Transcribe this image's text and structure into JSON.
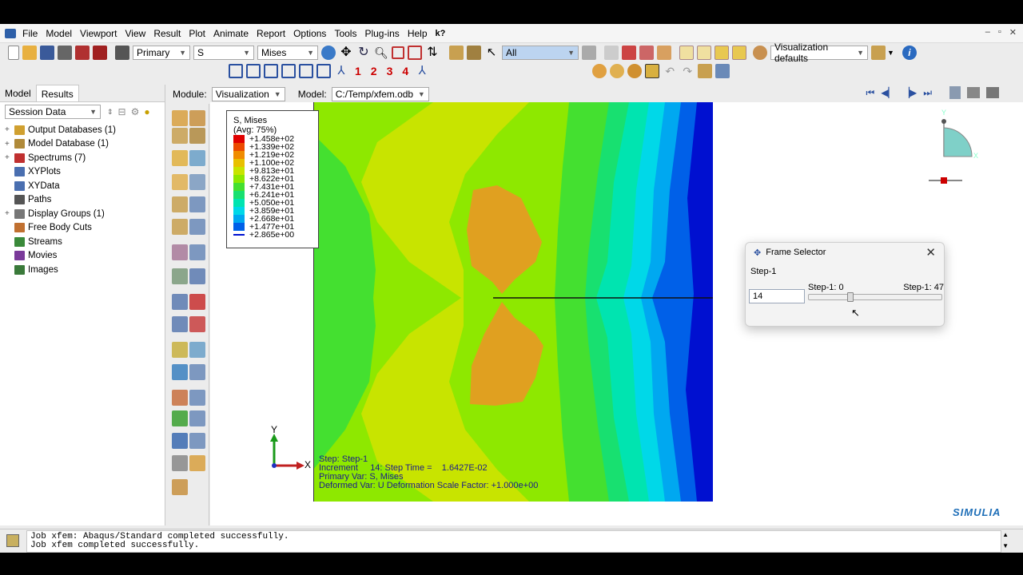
{
  "menu": [
    "File",
    "Model",
    "Viewport",
    "View",
    "Result",
    "Plot",
    "Animate",
    "Report",
    "Options",
    "Tools",
    "Plug-ins",
    "Help",
    "k?"
  ],
  "toolbar": {
    "primary": "Primary",
    "variable": "S",
    "component": "Mises",
    "selection": "All",
    "viz_defaults": "Visualization defaults",
    "view_numbers": [
      "1",
      "2",
      "3",
      "4"
    ]
  },
  "left_panel": {
    "tabs": [
      "Model",
      "Results"
    ],
    "active_tab": "Results",
    "session_select": "Session Data",
    "tree": [
      {
        "label": "Output Databases (1)",
        "expand": "+",
        "color": "#d0a030"
      },
      {
        "label": "Model Database (1)",
        "expand": "+",
        "color": "#b08a3a"
      },
      {
        "label": "Spectrums (7)",
        "expand": "+",
        "color": "#c03030"
      },
      {
        "label": "XYPlots",
        "expand": "",
        "color": "#4a6fb0"
      },
      {
        "label": "XYData",
        "expand": "",
        "color": "#4a6fb0"
      },
      {
        "label": "Paths",
        "expand": "",
        "color": "#555555"
      },
      {
        "label": "Display Groups (1)",
        "expand": "+",
        "color": "#777777"
      },
      {
        "label": "Free Body Cuts",
        "expand": "",
        "color": "#c07030"
      },
      {
        "label": "Streams",
        "expand": "",
        "color": "#3a8a3a"
      },
      {
        "label": "Movies",
        "expand": "",
        "color": "#7a3a9a"
      },
      {
        "label": "Images",
        "expand": "",
        "color": "#3a7a3a"
      }
    ]
  },
  "module": {
    "label": "Module:",
    "value": "Visualization",
    "model_label": "Model:",
    "model_value": "C:/Temp/xfem.odb"
  },
  "legend": {
    "title": "S, Mises",
    "avg": "(Avg: 75%)",
    "values": [
      "+1.458e+02",
      "+1.339e+02",
      "+1.219e+02",
      "+1.100e+02",
      "+9.813e+01",
      "+8.622e+01",
      "+7.431e+01",
      "+6.241e+01",
      "+5.050e+01",
      "+3.859e+01",
      "+2.668e+01",
      "+1.477e+01",
      "+2.865e+00"
    ],
    "colors": [
      "#e00000",
      "#ec4a00",
      "#f08c00",
      "#e8c000",
      "#c8e400",
      "#8ee800",
      "#44e030",
      "#18e070",
      "#00e4b0",
      "#00d8e8",
      "#00a8f0",
      "#0060e8",
      "#0010d0"
    ]
  },
  "step_info": {
    "line1": "Step: Step-1",
    "line2": "Increment     14: Step Time =    1.6427E-02",
    "line3": "Primary Var: S, Mises",
    "line4": "Deformed Var: U   Deformation Scale Factor: +1.000e+00"
  },
  "triad": {
    "x": "X",
    "y": "Y"
  },
  "frame_selector": {
    "title": "Frame Selector",
    "step": "Step-1",
    "value": "14",
    "min_label": "Step-1: 0",
    "max_label": "Step-1: 47",
    "position_fraction": 0.298
  },
  "console": {
    "line1": "Job xfem: Abaqus/Standard completed successfully.",
    "line2": "Job xfem completed successfully."
  },
  "brand": "SIMULIA"
}
